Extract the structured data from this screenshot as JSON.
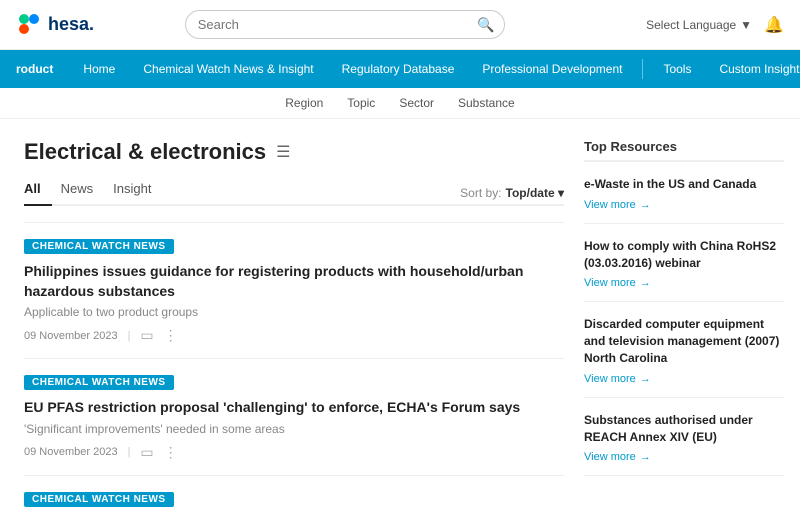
{
  "header": {
    "logo_text": "hesa.",
    "search_placeholder": "Search",
    "lang_label": "Select Language",
    "lang_icon": "▼"
  },
  "nav": {
    "product_label": "roduct",
    "items": [
      {
        "label": "Home"
      },
      {
        "label": "Chemical Watch News & Insight"
      },
      {
        "label": "Regulatory Database"
      },
      {
        "label": "Professional Development"
      },
      {
        "label": "Tools"
      },
      {
        "label": "Custom Insight"
      }
    ]
  },
  "sub_nav": {
    "items": [
      "Region",
      "Topic",
      "Sector",
      "Substance"
    ]
  },
  "page": {
    "title": "Electrical & electronics",
    "tabs": [
      {
        "label": "All",
        "active": true
      },
      {
        "label": "News"
      },
      {
        "label": "Insight"
      }
    ],
    "sort_label": "Sort by:",
    "sort_value": "Top/date ▾"
  },
  "articles": [
    {
      "badge": "CHEMICAL WATCH NEWS",
      "title": "Philippines issues guidance for registering products with household/urban hazardous substances",
      "subtitle": "Applicable to two product groups",
      "date": "09 November 2023"
    },
    {
      "badge": "CHEMICAL WATCH NEWS",
      "title": "EU PFAS restriction proposal 'challenging' to enforce, ECHA's Forum says",
      "subtitle": "'Significant improvements' needed in some areas",
      "date": "09 November 2023"
    },
    {
      "badge": "CHEMICAL WATCH NEWS",
      "title": "",
      "subtitle": "",
      "date": ""
    }
  ],
  "top_resources": {
    "title": "Top Resources",
    "items": [
      {
        "title": "e-Waste in the US and Canada",
        "view_more": "View more"
      },
      {
        "title": "How to comply with China RoHS2 (03.03.2016) webinar",
        "view_more": "View more"
      },
      {
        "title": "Discarded computer equipment and television management (2007) North Carolina",
        "view_more": "View more"
      },
      {
        "title": "Substances authorised under REACH Annex XIV (EU)",
        "view_more": "View more"
      }
    ]
  }
}
